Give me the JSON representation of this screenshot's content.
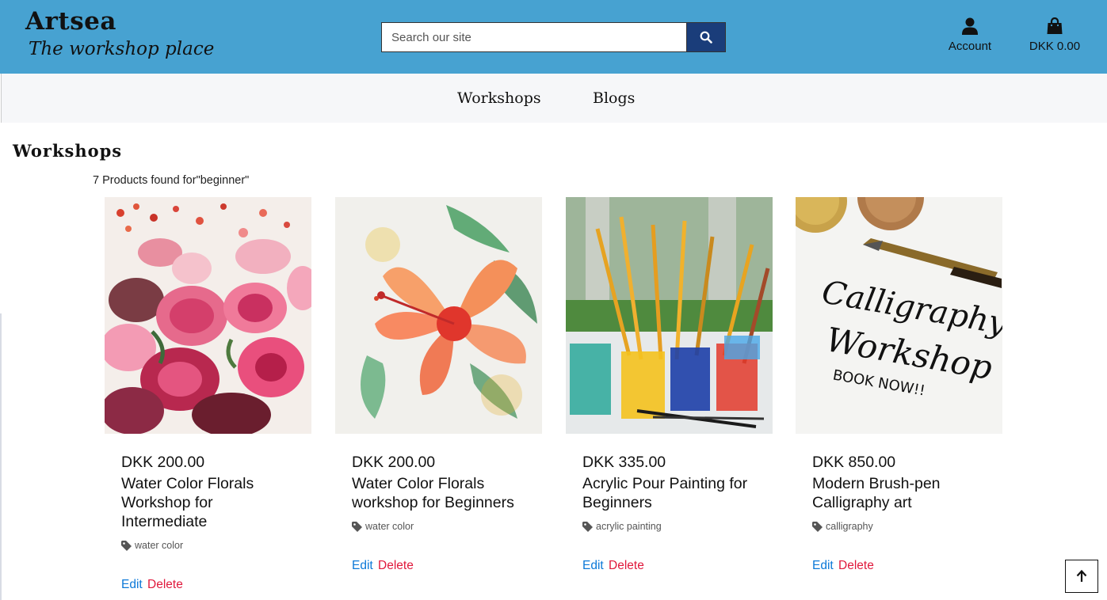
{
  "header": {
    "brand_title": "Artsea",
    "brand_tagline": "The workshop place",
    "search_placeholder": "Search our site",
    "account_label": "Account",
    "bag_total": "DKK 0.00",
    "bg_color": "#47a2d1",
    "search_button_color": "#1a3d7a"
  },
  "nav": {
    "items": [
      {
        "label": "Workshops"
      },
      {
        "label": "Blogs"
      }
    ]
  },
  "main": {
    "title": "Workshops",
    "results_text": "7 Products found for\"beginner\"",
    "products": [
      {
        "price": "DKK 200.00",
        "name": "Water Color Florals Workshop for Intermediate",
        "category": "water color",
        "edit": "Edit",
        "delete": "Delete",
        "image": "pink peony watercolor"
      },
      {
        "price": "DKK 200.00",
        "name": "Water Color Florals workshop for Beginners",
        "category": "water color",
        "edit": "Edit",
        "delete": "Delete",
        "image": "orange hibiscus watercolor"
      },
      {
        "price": "DKK 335.00",
        "name": "Acrylic Pour Painting for Beginners",
        "category": "acrylic painting",
        "edit": "Edit",
        "delete": "Delete",
        "image": "paint brushes in cups"
      },
      {
        "price": "DKK 850.00",
        "name": "Modern Brush-pen Calligraphy art",
        "category": "calligraphy",
        "edit": "Edit",
        "delete": "Delete",
        "image": "calligraphy workshop pen",
        "image_text": [
          "Calligraphy",
          "Workshop",
          "BOOK NOW!!"
        ]
      }
    ]
  },
  "colors": {
    "edit": "#0b78d8",
    "delete": "#e0193c"
  },
  "icons": {
    "search": "search-icon",
    "account": "user-icon",
    "bag": "shopping-bag-icon",
    "tag": "tag-icon",
    "to_top": "arrow-up-icon"
  }
}
